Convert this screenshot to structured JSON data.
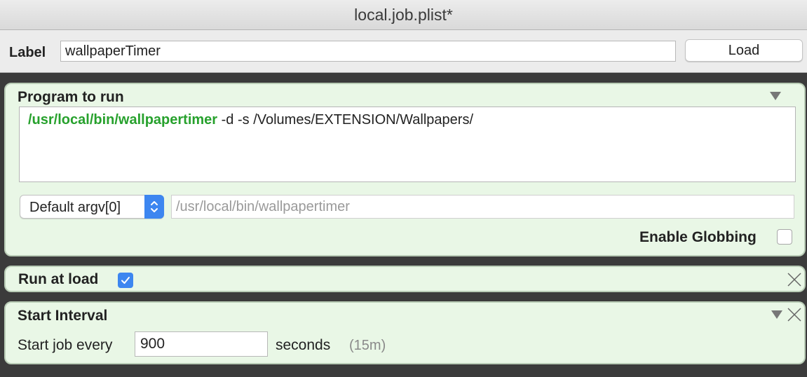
{
  "window": {
    "title": "local.job.plist*"
  },
  "label_bar": {
    "label_text": "Label",
    "label_value": "wallpaperTimer",
    "load_button": "Load"
  },
  "program_panel": {
    "title": "Program to run",
    "executable": "/usr/local/bin/wallpapertimer",
    "arguments": " -d -s /Volumes/EXTENSION/Wallpapers/",
    "argv_select": "Default argv[0]",
    "argv_placeholder": "/usr/local/bin/wallpapertimer",
    "globbing_label": "Enable Globbing",
    "globbing_checked": false
  },
  "run_at_load_panel": {
    "title": "Run at load",
    "checked": true
  },
  "start_interval_panel": {
    "title": "Start Interval",
    "prefix": "Start job every",
    "value": "900",
    "unit": "seconds",
    "hint": "(15m)"
  },
  "icons": {
    "collapse": "disclosure-triangle-icon",
    "remove": "close-icon",
    "stepper": "up-down-chevron-icon",
    "check": "checkmark-icon"
  },
  "colors": {
    "panel_bg": "#e9f7e6",
    "executable_green": "#27a12d",
    "accent_blue": "#3d86f0"
  }
}
